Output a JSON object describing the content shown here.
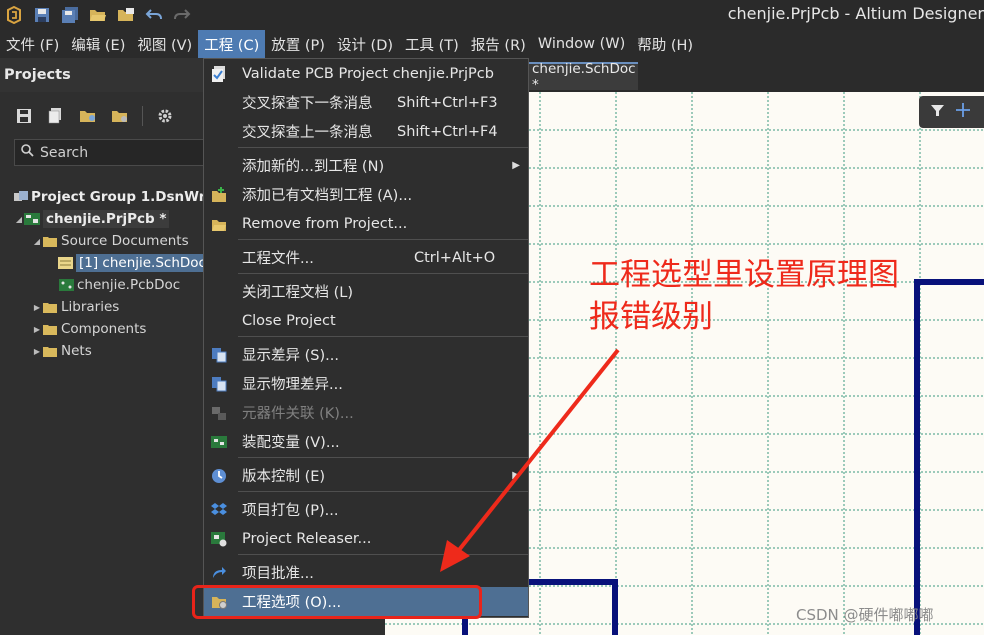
{
  "window": {
    "title": "chenjie.PrjPcb - Altium Designer"
  },
  "quick_access_icons": [
    "altium-logo-icon",
    "save-icon",
    "save-all-icon",
    "open-icon",
    "open-project-icon",
    "undo-icon",
    "redo-icon"
  ],
  "menubar": {
    "items": [
      {
        "label": "文件 (F)"
      },
      {
        "label": "编辑 (E)"
      },
      {
        "label": "视图 (V)"
      },
      {
        "label": "工程 (C)"
      },
      {
        "label": "放置 (P)"
      },
      {
        "label": "设计 (D)"
      },
      {
        "label": "工具 (T)"
      },
      {
        "label": "报告 (R)"
      },
      {
        "label": "Window (W)"
      },
      {
        "label": "帮助 (H)"
      }
    ],
    "active_index": 3
  },
  "projects_panel": {
    "title": "Projects",
    "search_placeholder": "Search",
    "tree": [
      {
        "label": "Project Group 1.DsnWrk"
      },
      {
        "label": "chenjie.PrjPcb *"
      },
      {
        "label": "Source Documents"
      },
      {
        "label": "[1] chenjie.SchDoc *"
      },
      {
        "label": "chenjie.PcbDoc"
      },
      {
        "label": "Libraries"
      },
      {
        "label": "Components"
      },
      {
        "label": "Nets"
      }
    ]
  },
  "document_tab": {
    "label": "chenjie.SchDoc *"
  },
  "project_menu": {
    "items": [
      {
        "label": "Validate PCB Project chenjie.PrjPcb",
        "shortcut": "",
        "icon": "validate-icon"
      },
      {
        "label": "交叉探查下一条消息",
        "shortcut": "Shift+Ctrl+F3",
        "icon": ""
      },
      {
        "label": "交叉探查上一条消息",
        "shortcut": "Shift+Ctrl+F4",
        "icon": ""
      },
      {
        "label": "添加新的...到工程 (N)",
        "shortcut": "",
        "icon": "",
        "submenu": true
      },
      {
        "label": "添加已有文档到工程 (A)...",
        "shortcut": "",
        "icon": "add-document-icon"
      },
      {
        "label": "Remove from Project...",
        "shortcut": "",
        "icon": "remove-document-icon"
      },
      {
        "label": "工程文件...",
        "shortcut": "Ctrl+Alt+O",
        "icon": ""
      },
      {
        "label": "关闭工程文档 (L)",
        "shortcut": "",
        "icon": ""
      },
      {
        "label": "Close Project",
        "shortcut": "",
        "icon": ""
      },
      {
        "label": "显示差异 (S)...",
        "shortcut": "",
        "icon": "show-differences-icon"
      },
      {
        "label": "显示物理差异...",
        "shortcut": "",
        "icon": "show-physical-differences-icon"
      },
      {
        "label": "元器件关联 (K)...",
        "shortcut": "",
        "icon": "component-links-icon",
        "disabled": true
      },
      {
        "label": "装配变量 (V)...",
        "shortcut": "",
        "icon": "variants-icon"
      },
      {
        "label": "版本控制 (E)",
        "shortcut": "",
        "icon": "version-control-icon",
        "submenu": true
      },
      {
        "label": "项目打包 (P)...",
        "shortcut": "",
        "icon": "dropbox-icon"
      },
      {
        "label": "Project Releaser...",
        "shortcut": "",
        "icon": "releaser-icon"
      },
      {
        "label": "项目批准...",
        "shortcut": "",
        "icon": "approve-icon"
      },
      {
        "label": "工程选项 (O)...",
        "shortcut": "",
        "icon": "project-options-icon",
        "highlighted": true
      }
    ]
  },
  "annotation": {
    "text": "工程选型里设置原理图报错级别",
    "color": "#ee2a1b"
  },
  "watermark": "CSDN @硬件嘟嘟嘟",
  "colors": {
    "menu_active": "#4e7bb2",
    "selection": "#4e6f93",
    "wire": "#08117a",
    "grid": "#3b9a7e",
    "sheet": "#fdfbf5"
  }
}
